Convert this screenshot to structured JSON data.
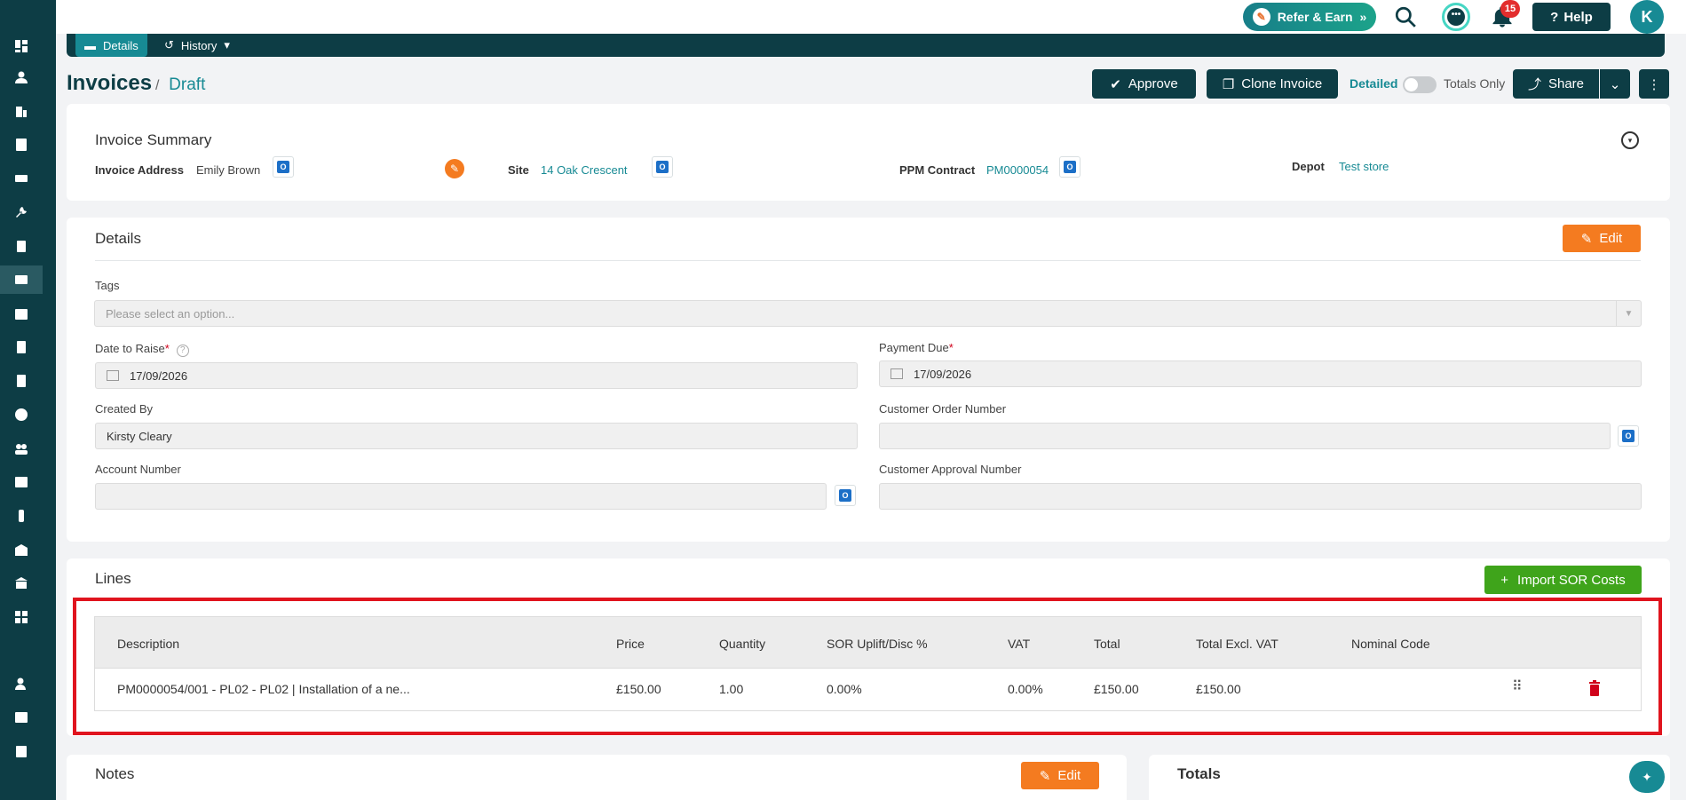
{
  "topbar": {
    "refer_label": "Refer & Earn",
    "notification_count": "15",
    "help_label": "Help",
    "avatar_initial": "K"
  },
  "tabs": {
    "details": "Details",
    "history": "History"
  },
  "header": {
    "title": "Invoices",
    "separator": "/",
    "status": "Draft",
    "approve_label": "Approve",
    "clone_label": "Clone Invoice",
    "detailed_label": "Detailed",
    "totals_only_label": "Totals Only",
    "share_label": "Share"
  },
  "summary": {
    "title": "Invoice Summary",
    "invoice_address_label": "Invoice Address",
    "invoice_address_value": "Emily Brown",
    "site_label": "Site",
    "site_value": "14 Oak Crescent",
    "ppm_label": "PPM Contract",
    "ppm_value": "PM0000054",
    "depot_label": "Depot",
    "depot_value": "Test store"
  },
  "details": {
    "title": "Details",
    "edit_label": "Edit",
    "tags_label": "Tags",
    "tags_placeholder": "Please select an option...",
    "date_to_raise_label": "Date to Raise",
    "date_to_raise_value": "17/09/2026",
    "payment_due_label": "Payment Due",
    "payment_due_value": "17/09/2026",
    "created_by_label": "Created By",
    "created_by_value": "Kirsty Cleary",
    "customer_order_label": "Customer Order Number",
    "customer_order_value": "",
    "account_number_label": "Account Number",
    "account_number_value": "",
    "customer_approval_label": "Customer Approval Number",
    "customer_approval_value": "",
    "required_mark": "*",
    "help_mark": "?"
  },
  "lines": {
    "title": "Lines",
    "import_label": "Import SOR Costs",
    "columns": [
      "Description",
      "Price",
      "Quantity",
      "SOR Uplift/Disc %",
      "VAT",
      "Total",
      "Total Excl. VAT",
      "Nominal Code"
    ],
    "rows": [
      {
        "description": "PM0000054/001 - PL02 - PL02 | Installation of a ne...",
        "price": "£150.00",
        "quantity": "1.00",
        "uplift": "0.00%",
        "vat": "0.00%",
        "total": "£150.00",
        "total_excl_vat": "£150.00",
        "nominal_code": ""
      }
    ]
  },
  "notes": {
    "title": "Notes",
    "edit_label": "Edit"
  },
  "totals": {
    "title": "Totals"
  },
  "colors": {
    "brand_dark": "#0d3d45",
    "accent_teal": "#178a94",
    "orange": "#f47b20",
    "green": "#3fa41b",
    "highlight_red": "#e0141e"
  }
}
